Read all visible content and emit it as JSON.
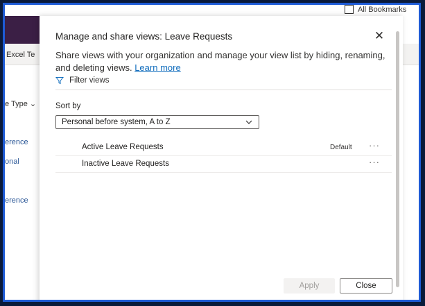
{
  "background": {
    "bookmarks_label": "All Bookmarks",
    "toolbar_excel": "Excel Te",
    "column_header": "e Type",
    "rows": [
      "erence",
      "onal",
      "erence"
    ]
  },
  "dialog": {
    "title": "Manage and share views: Leave Requests",
    "description": "Share views with your organization and manage your view list by hiding, renaming, and deleting views.",
    "learn_more": "Learn more",
    "filter_label": "Filter views",
    "sort_by_label": "Sort by",
    "sort_by_value": "Personal before system, A to Z",
    "views": [
      {
        "name": "Active Leave Requests",
        "badge": "Default",
        "more": "···"
      },
      {
        "name": "Inactive Leave Requests",
        "badge": "",
        "more": "···"
      }
    ],
    "apply_label": "Apply",
    "close_label": "Close"
  },
  "colors": {
    "frame_border": "#1e5bd6",
    "link": "#0f6cbd",
    "purple_nav": "#3b1f45"
  }
}
